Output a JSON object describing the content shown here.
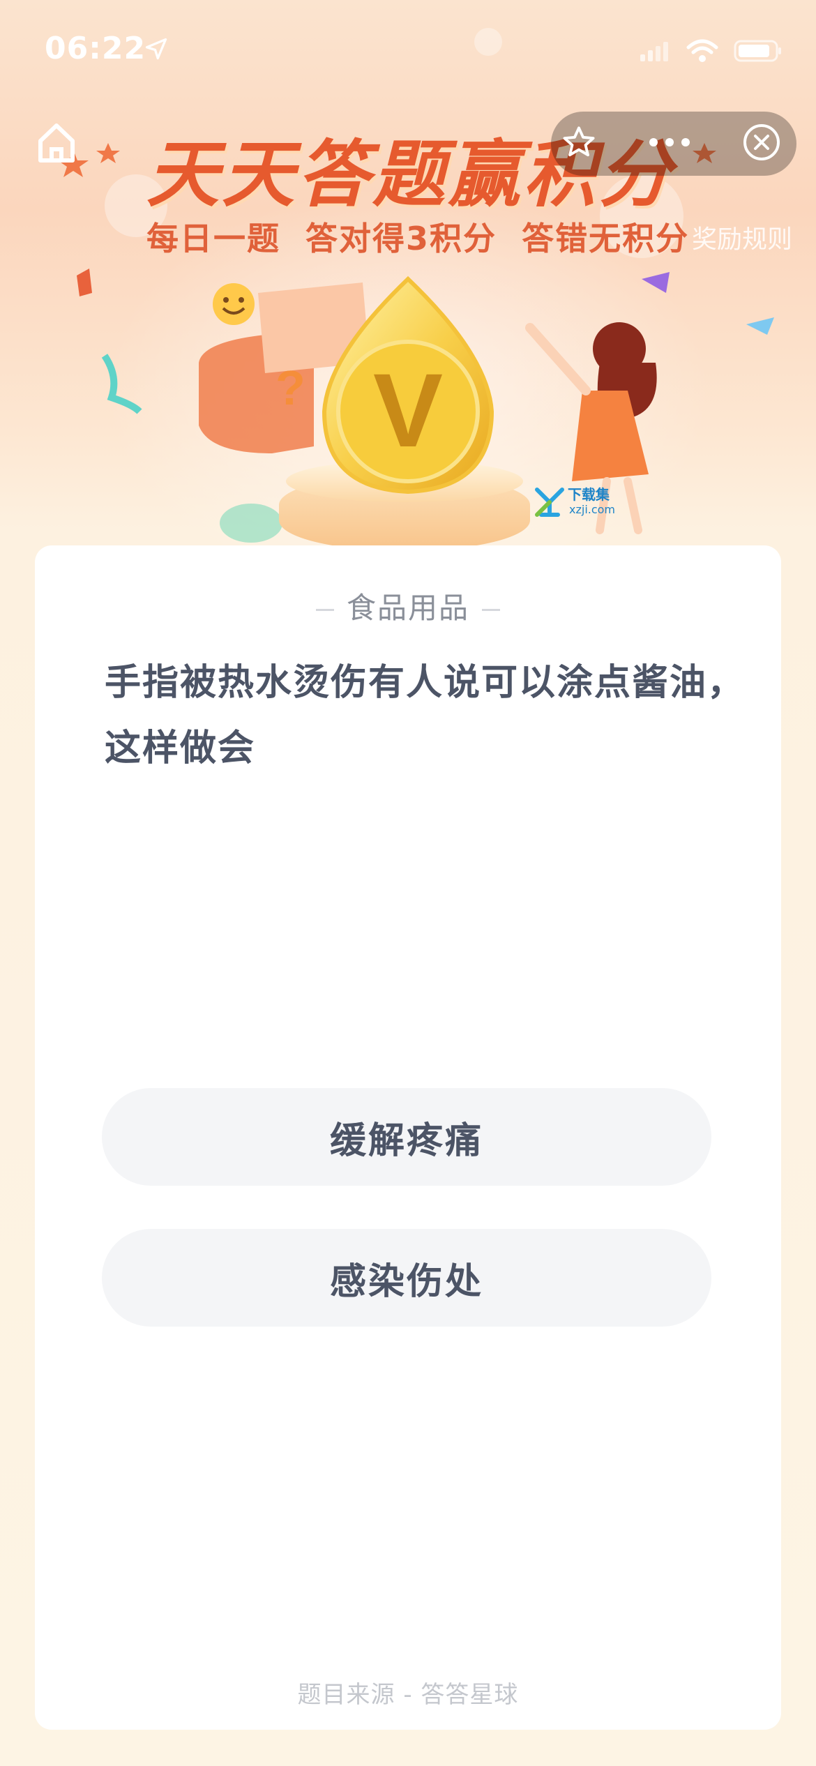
{
  "status_bar": {
    "time": "06:22",
    "icons": [
      "location-arrow-icon",
      "signal-icon",
      "wifi-icon",
      "battery-icon"
    ]
  },
  "nav": {
    "icons": [
      "home-icon",
      "star-icon",
      "more-icon",
      "close-icon"
    ]
  },
  "banner": {
    "title": "天天答题赢积分",
    "subtitle": "每日一题  答对得3积分  答错无积分",
    "rules_link": "奖励规则",
    "coin_letter": "V",
    "watermark_cn": "下载集",
    "watermark_en": "xzji.com"
  },
  "quiz": {
    "category": "食品用品",
    "question": "手指被热水烫伤有人说可以涂点酱油，这样做会",
    "options": [
      "缓解疼痛",
      "感染伤处"
    ],
    "source": "题目来源 - 答答星球"
  },
  "colors": {
    "title": "#e65a2e",
    "text": "#4c5466",
    "option_bg": "#f4f5f7"
  }
}
